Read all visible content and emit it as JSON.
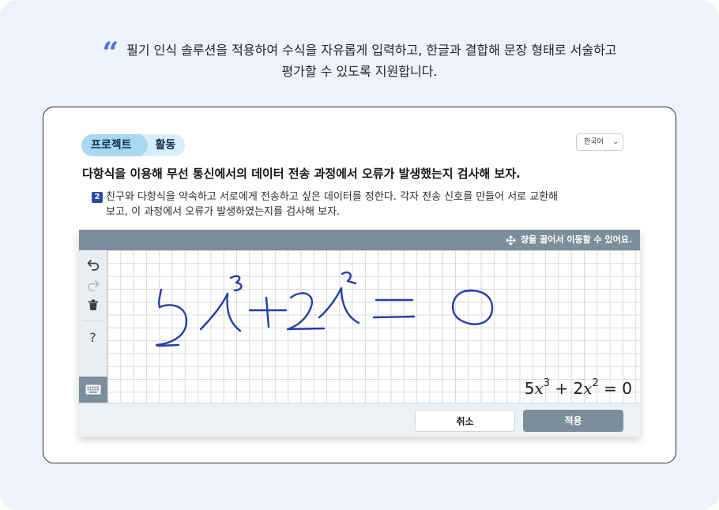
{
  "intro": {
    "line1": "필기 인식 솔루션을 적용하여 수식을 자유롭게 입력하고, 한글과 결합해 문장 형태로 서술하고",
    "line2": "평가할 수 있도록 지원합니다."
  },
  "card": {
    "tag_primary": "프로젝트",
    "tag_secondary": "활동",
    "language": "한국어",
    "question_title": "다항식을 이용해 무선 통신에서의 데이터 전송 과정에서 오류가 발생했는지 검사해 보자.",
    "question_number": "2",
    "question_desc_line1": "친구와 다항식을 약속하고 서로에게 전송하고 싶은 데이터를 정한다. 각자 전송 신호를 만들어 서로 교환해",
    "question_desc_line2": "보고, 이 과정에서 오류가 발생하였는지를 검사해 보자."
  },
  "editor": {
    "drag_hint": "창을 끌어서 이동할 수 있어요.",
    "help_label": "?",
    "recognized": {
      "c1": "5",
      "v1": "x",
      "e1": "3",
      "op": "+",
      "c2": "2",
      "v2": "x",
      "e2": "2",
      "eq": "=",
      "rhs": "0"
    },
    "cancel_label": "취소",
    "apply_label": "적용"
  },
  "colors": {
    "accent": "#4b72e6",
    "tag_primary_bg": "#a9d8f3",
    "tag_secondary_bg": "#d6eefb",
    "toolbar": "#7b8e9c",
    "ink": "#243ea8"
  }
}
